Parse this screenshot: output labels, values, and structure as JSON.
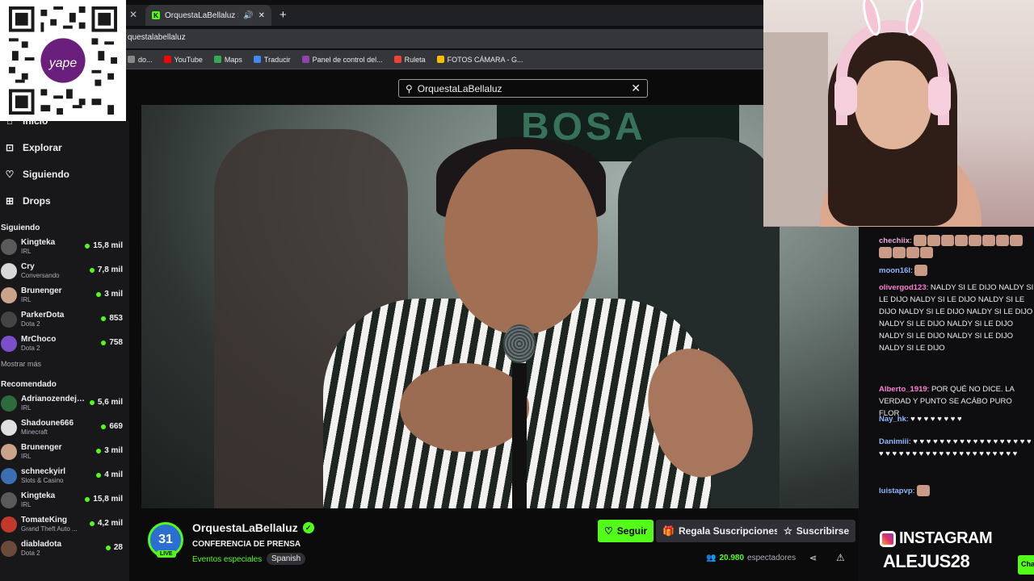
{
  "browser": {
    "tab_title": "OrquestaLaBellaluz Stream",
    "url": "questalabellaluz",
    "bookmarks": [
      {
        "label": "do...",
        "color": "#888888"
      },
      {
        "label": "YouTube",
        "color": "#ff0000"
      },
      {
        "label": "Maps",
        "color": "#34a853"
      },
      {
        "label": "Traducir",
        "color": "#4285f4"
      },
      {
        "label": "Panel de control del...",
        "color": "#8e44ad"
      },
      {
        "label": "Ruleta",
        "color": "#ea4335"
      },
      {
        "label": "FOTOS CÁMARA - G...",
        "color": "#fbbc04"
      }
    ]
  },
  "qr": {
    "brand": "yape"
  },
  "sidebar": {
    "nav": [
      {
        "label": "Inicio",
        "icon": "home-icon"
      },
      {
        "label": "Explorar",
        "icon": "compass-icon"
      },
      {
        "label": "Siguiendo",
        "icon": "heart-icon"
      },
      {
        "label": "Drops",
        "icon": "drops-icon"
      }
    ],
    "following_title": "Siguiendo",
    "following": [
      {
        "name": "Kingteka",
        "category": "IRL",
        "viewers": "15,8 mil",
        "color": "#5a5a5a"
      },
      {
        "name": "Cry",
        "category": "Conversando",
        "viewers": "7,8 mil",
        "color": "#d8d8d8"
      },
      {
        "name": "Brunenger",
        "category": "IRL",
        "viewers": "3 mil",
        "color": "#c9a48a"
      },
      {
        "name": "ParkerDota",
        "category": "Dota 2",
        "viewers": "853",
        "color": "#444444"
      },
      {
        "name": "MrChoco",
        "category": "Dota 2",
        "viewers": "758",
        "color": "#7b4fc9"
      }
    ],
    "show_more": "Mostrar más",
    "recommended_title": "Recomendado",
    "recommended": [
      {
        "name": "Adrianozendeja...",
        "category": "IRL",
        "viewers": "5,6 mil",
        "color": "#2e6b3c"
      },
      {
        "name": "Shadoune666",
        "category": "Minecraft",
        "viewers": "669",
        "color": "#e0e0e0"
      },
      {
        "name": "Brunenger",
        "category": "IRL",
        "viewers": "3 mil",
        "color": "#c9a48a"
      },
      {
        "name": "schneckyirl",
        "category": "Slots & Casino",
        "viewers": "4 mil",
        "color": "#3a6fb0"
      },
      {
        "name": "Kingteka",
        "category": "IRL",
        "viewers": "15,8 mil",
        "color": "#5a5a5a"
      },
      {
        "name": "TomateKing",
        "category": "Grand Theft Auto ...",
        "viewers": "4,2 mil",
        "color": "#c0392b"
      },
      {
        "name": "diabladota",
        "category": "Dota 2",
        "viewers": "28",
        "color": "#6b4a3a"
      }
    ]
  },
  "search": {
    "value": "OrquestaLaBellaluz"
  },
  "video": {
    "banner_text": "BOSA"
  },
  "stream": {
    "avatar_text": "31",
    "live_badge": "LIVE",
    "channel_name": "OrquestaLaBellaluz",
    "title": "CONFERENCIA DE PRENSA",
    "category": "Eventos especiales",
    "language": "Spanish",
    "follow_label": "Seguir",
    "gift_label": "Regala Suscripciones",
    "subscribe_label": "Suscribirse",
    "viewer_count": "20.980",
    "viewer_suffix": "espectadores"
  },
  "chat": {
    "messages": [
      {
        "user": "chechiix",
        "text": "",
        "color": "#f0a6d8",
        "emotes": 12
      },
      {
        "user": "moon16l",
        "text": "",
        "color": "#8fb7ff",
        "emotes": 1
      },
      {
        "user": "olivergod123",
        "text": "NALDY SI LE DIJO NALDY SI LE DIJO NALDY SI LE DIJO NALDY SI LE DIJO NALDY SI LE DIJO NALDY SI LE DIJO NALDY SI LE DIJO NALDY SI LE DIJO NALDY SI LE DIJO NALDY SI LE DIJO NALDY SI LE DIJO",
        "color": "#ff7fd1",
        "emotes": 0
      },
      {
        "user": "Alberto_1919",
        "text": "POR QUÉ NO DICE. LA VERDAD Y PUNTO SE ACÁBO PURO FLOR",
        "color": "#ff7fd1",
        "emotes": 0
      },
      {
        "user": "Nay_hk",
        "text": "♥ ♥ ♥ ♥ ♥ ♥ ♥ ♥",
        "color": "#8fb7ff",
        "emotes": 0
      },
      {
        "user": "Danimiii",
        "text": "♥ ♥ ♥ ♥ ♥ ♥ ♥ ♥ ♥ ♥ ♥ ♥ ♥ ♥ ♥ ♥ ♥ ♥ ♥ ♥ ♥ ♥ ♥ ♥ ♥ ♥ ♥ ♥ ♥ ♥ ♥ ♥ ♥ ♥ ♥ ♥ ♥ ♥ ♥",
        "color": "#8fb7ff",
        "emotes": 0
      },
      {
        "user": "luistapvp",
        "text": "",
        "color": "#8fb7ff",
        "emotes": 1
      }
    ],
    "overlay_instagram": "INSTAGRAM",
    "overlay_handle": "ALEJUS28",
    "chat_button": "Cha"
  },
  "colors": {
    "accent": "#53fc18",
    "background": "#0e0e10",
    "sidebar": "#18181b"
  }
}
